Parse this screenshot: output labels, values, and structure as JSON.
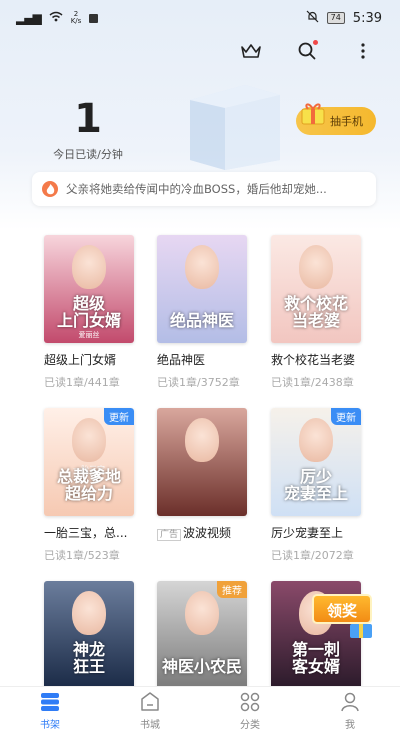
{
  "status_bar": {
    "net_speed_top": "2",
    "net_speed_unit": "K/s",
    "battery": "74",
    "time": "5:39"
  },
  "stats": {
    "value": "1",
    "label": "今日已读/分钟"
  },
  "draw_button": {
    "label": "抽手机"
  },
  "notice": {
    "text": "父亲将她卖给传闻中的冷血BOSS，婚后他却宠她..."
  },
  "books": [
    {
      "title": "超级上门女婿",
      "progress": "已读1章/441章",
      "cover_text": "超级\n上门女婿",
      "cover_author": "爱丽丝",
      "colors": [
        "#c24a6c",
        "#f7d5dc"
      ]
    },
    {
      "title": "绝品神医",
      "progress": "已读1章/3752章",
      "cover_text": "绝品神医",
      "colors": [
        "#b3bde6",
        "#e7d7f2"
      ]
    },
    {
      "title": "救个校花当老婆",
      "progress": "已读1章/2438章",
      "cover_text": "救个校花\n当老婆",
      "colors": [
        "#f2c6c0",
        "#fbe9e4"
      ]
    },
    {
      "title": "一胎三宝，总...",
      "progress": "已读1章/523章",
      "cover_text": "总裁爹地\n超给力",
      "cover_small": "一胎三宝",
      "badge": "更新",
      "colors": [
        "#f6c9b2",
        "#fff0e8"
      ]
    },
    {
      "title": "波波视频",
      "ad_tag": "广告",
      "progress": "",
      "cover_text": "",
      "colors": [
        "#6b2f2a",
        "#d9a79d"
      ]
    },
    {
      "title": "厉少宠妻至上",
      "progress": "已读1章/2072章",
      "cover_text": "厉少\n宠妻至上",
      "badge": "更新",
      "colors": [
        "#cfe0f5",
        "#f6f1ea"
      ]
    },
    {
      "title": "",
      "progress": "",
      "cover_text": "神龙\n狂王",
      "colors": [
        "#1a2a46",
        "#6b7d9c"
      ]
    },
    {
      "title": "",
      "progress": "",
      "cover_text": "神医小农民",
      "badge": "推荐",
      "colors": [
        "#7a7a7a",
        "#d5d5d5"
      ]
    },
    {
      "title": "",
      "progress": "",
      "cover_text": "第一刺\n客女婿",
      "colors": [
        "#2a1a2a",
        "#8a4a6a"
      ]
    }
  ],
  "bonus": {
    "label": "领奖"
  },
  "nav": [
    {
      "label": "书架",
      "icon": "bookshelf-icon",
      "active": true
    },
    {
      "label": "书城",
      "icon": "bookstore-icon"
    },
    {
      "label": "分类",
      "icon": "category-icon"
    },
    {
      "label": "我",
      "icon": "profile-icon"
    }
  ],
  "colors": {
    "accent": "#2f7cf6",
    "gold": "#f5b82e",
    "badge_new": "#3a8df5",
    "badge_rec": "#f0a13a"
  }
}
